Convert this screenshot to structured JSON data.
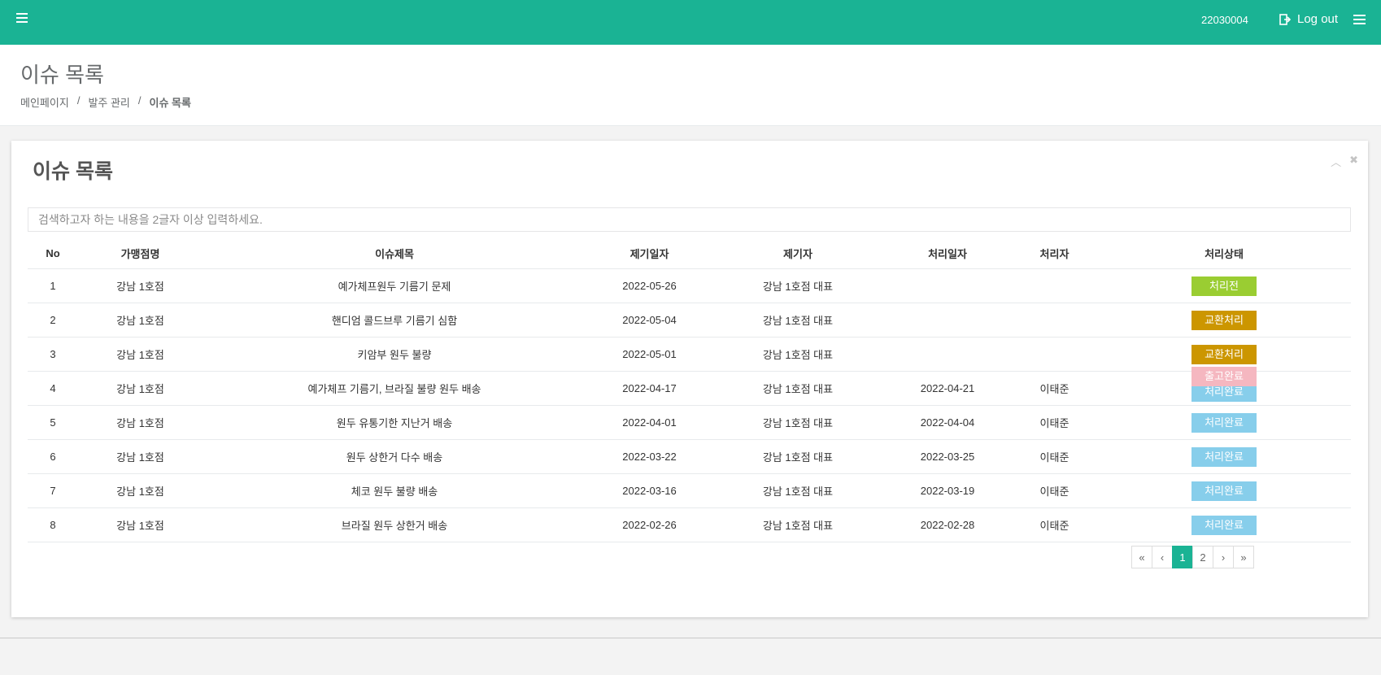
{
  "topbar": {
    "user_id": "22030004",
    "logout_label": "Log out"
  },
  "page_header": {
    "title": "이슈 목록",
    "breadcrumb": [
      "메인페이지",
      "발주 관리",
      "이슈 목록"
    ]
  },
  "card": {
    "title": "이슈 목록",
    "search_placeholder": "검색하고자 하는 내용을 2글자 이상 입력하세요."
  },
  "table": {
    "headers": [
      "No",
      "가맹점명",
      "이슈제목",
      "제기일자",
      "제기자",
      "처리일자",
      "처리자",
      "처리상태"
    ],
    "rows": [
      {
        "no": "1",
        "store": "강남 1호점",
        "title": "예가체프원두 기름기 문제",
        "raised": "2022-05-26",
        "raiser": "강남 1호점 대표",
        "processed": "",
        "handler": "",
        "status": "처리전"
      },
      {
        "no": "2",
        "store": "강남 1호점",
        "title": "핸디엄 콜드브루 기름기 심함",
        "raised": "2022-05-04",
        "raiser": "강남 1호점 대표",
        "processed": "",
        "handler": "",
        "status": "교환처리"
      },
      {
        "no": "3",
        "store": "강남 1호점",
        "title": "키암부 원두 불량",
        "raised": "2022-05-01",
        "raiser": "강남 1호점 대표",
        "processed": "",
        "handler": "",
        "status": "교환처리"
      },
      {
        "no": "4",
        "store": "강남 1호점",
        "title": "예가체프 기름기, 브라질 불량 원두 배송",
        "raised": "2022-04-17",
        "raiser": "강남 1호점 대표",
        "processed": "2022-04-21",
        "handler": "이태준",
        "status": "처리완료",
        "overlay_status": "출고완료"
      },
      {
        "no": "5",
        "store": "강남 1호점",
        "title": "원두 유통기한 지난거 배송",
        "raised": "2022-04-01",
        "raiser": "강남 1호점 대표",
        "processed": "2022-04-04",
        "handler": "이태준",
        "status": "처리완료"
      },
      {
        "no": "6",
        "store": "강남 1호점",
        "title": "원두 상한거 다수 배송",
        "raised": "2022-03-22",
        "raiser": "강남 1호점 대표",
        "processed": "2022-03-25",
        "handler": "이태준",
        "status": "처리완료"
      },
      {
        "no": "7",
        "store": "강남 1호점",
        "title": "체코 원두 불량 배송",
        "raised": "2022-03-16",
        "raiser": "강남 1호점 대표",
        "processed": "2022-03-19",
        "handler": "이태준",
        "status": "처리완료"
      },
      {
        "no": "8",
        "store": "강남 1호점",
        "title": "브라질 원두 상한거 배송",
        "raised": "2022-02-26",
        "raiser": "강남 1호점 대표",
        "processed": "2022-02-28",
        "handler": "이태준",
        "status": "처리완료"
      }
    ]
  },
  "pagination": {
    "first": "«",
    "prev": "‹",
    "pages": [
      "1",
      "2"
    ],
    "next": "›",
    "last": "»",
    "current": "1"
  },
  "colors": {
    "primary": "#1ab394",
    "status_before": "#9acd32",
    "status_exchange": "#cc9600",
    "status_done": "#87ceeb",
    "status_shipped": "#f5b7c0"
  }
}
